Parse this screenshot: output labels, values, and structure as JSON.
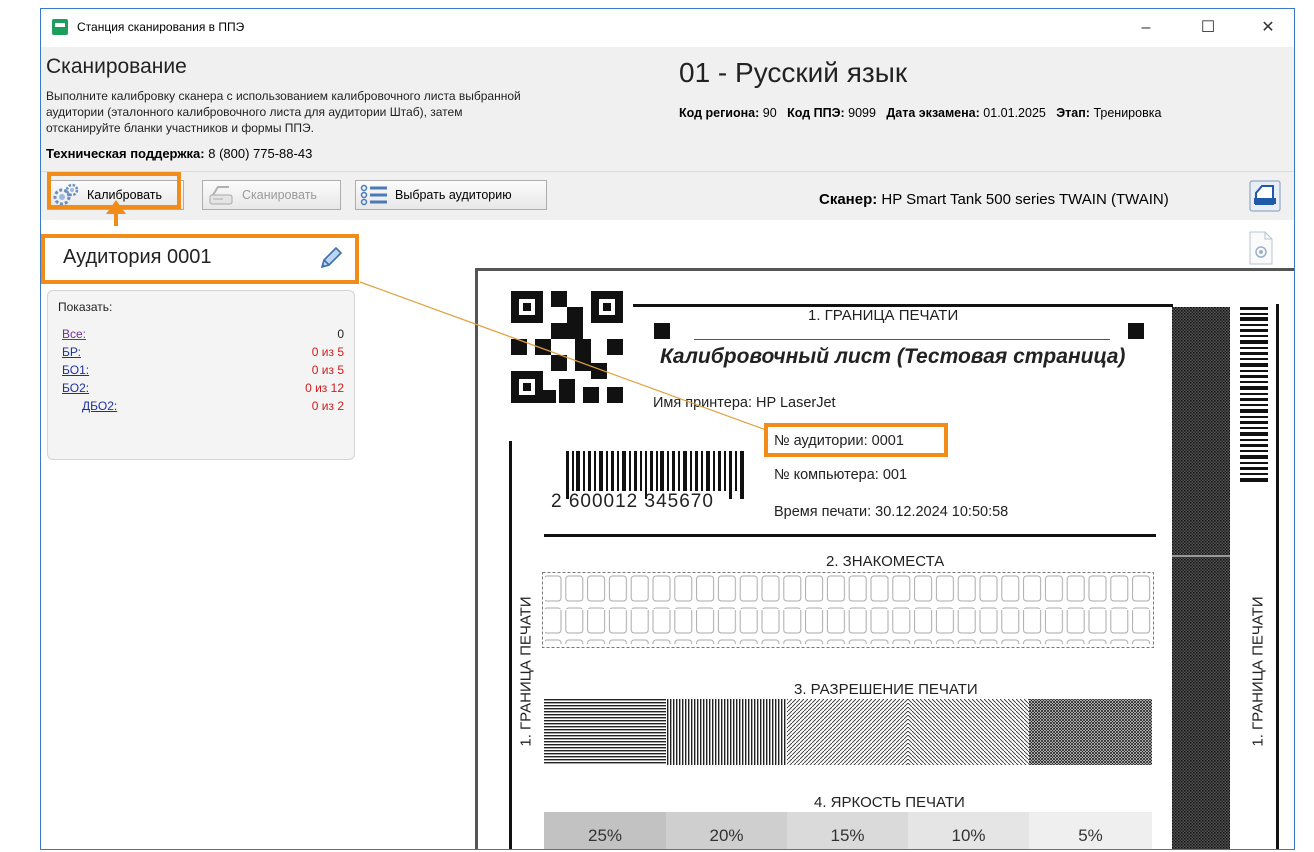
{
  "window": {
    "title": "Станция сканирования в ППЭ",
    "controls": {
      "minimize": "–",
      "maximize": "☐",
      "close": "✕"
    }
  },
  "header": {
    "title": "Сканирование",
    "description_lines": [
      "Выполните калибровку сканера с использованием калибровочного листа выбранной",
      "аудитории (эталонного калибровочного листа для аудитории Штаб), затем",
      "отсканируйте бланки участников и формы ППЭ."
    ],
    "support_label": "Техническая поддержка:",
    "support_value": "8 (800) 775-88-43",
    "subject": "01 - Русский язык",
    "meta": [
      {
        "label": "Код региона:",
        "value": "90"
      },
      {
        "label": "Код ППЭ:",
        "value": "9099"
      },
      {
        "label": "Дата экзамена:",
        "value": "01.01.2025"
      },
      {
        "label": "Этап:",
        "value": "Тренировка"
      }
    ]
  },
  "toolbar": {
    "calibrate_label": "Калибровать",
    "scan_label": "Сканировать",
    "select_room_label": "Выбрать аудиторию",
    "scanner_label": "Сканер:",
    "scanner_value": "HP Smart Tank 500 series TWAIN (TWAIN)"
  },
  "room": {
    "name": "Аудитория 0001",
    "show_label": "Показать:",
    "filters": [
      {
        "label": "Все:",
        "count": "0",
        "status": "neutral"
      },
      {
        "label": "БР:",
        "count": "0 из 5",
        "status": "warn"
      },
      {
        "label": "БО1:",
        "count": "0 из 5",
        "status": "warn"
      },
      {
        "label": "БО2:",
        "count": "0 из 12",
        "status": "warn"
      },
      {
        "label": "ДБО2:",
        "count": "0 из 2",
        "status": "warn"
      }
    ]
  },
  "calibration_sheet": {
    "section1": "1. ГРАНИЦА ПЕЧАТИ",
    "title": "Калибровочный лист (Тестовая страница)",
    "printer_label": "Имя принтера:",
    "printer_value": "HP LaserJet",
    "room_line": "№ аудитории: 0001",
    "computer_line": "№ компьютера: 001",
    "print_time_line": "Время печати: 30.12.2024 10:50:58",
    "barcode_number": "2 600012 345670",
    "section2": "2. ЗНАКОМЕСТА",
    "section3": "3. РАЗРЕШЕНИЕ ПЕЧАТИ",
    "section4": "4. ЯРКОСТЬ ПЕЧАТИ",
    "side_label_left": "1. ГРАНИЦА ПЕЧАТИ",
    "side_label_right": "1. ГРАНИЦА ПЕЧАТИ",
    "brightness_levels": [
      "25%",
      "20%",
      "15%",
      "10%",
      "5%"
    ]
  },
  "colors": {
    "accent_orange": "#f08c1a",
    "link_blue": "#1b2fa0",
    "count_red": "#d01c1c",
    "window_border": "#3a78c8"
  }
}
